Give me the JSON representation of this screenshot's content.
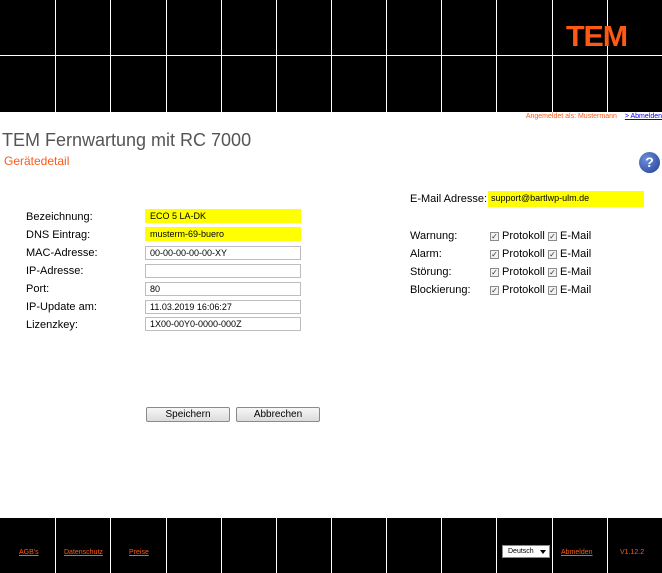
{
  "header": {
    "logo": "TEM"
  },
  "userbar": {
    "logged_in_as": "Angemeldet als: Mustermann",
    "logout": "> Abmelden"
  },
  "page": {
    "title": "TEM Fernwartung mit RC 7000",
    "subtitle": "Gerätedetail",
    "help": "?"
  },
  "device": {
    "name_label": "Bezeichnung:",
    "name": "ECO 5 LA-DK",
    "dns_label": "DNS Eintrag:",
    "dns": "musterm-69-buero",
    "mac_label": "MAC-Adresse:",
    "mac": "00-00-00-00-00-XY",
    "ip_label": "IP-Adresse:",
    "ip": "",
    "port_label": "Port:",
    "port": "80",
    "ipupdate_label": "IP-Update am:",
    "ipupdate": "11.03.2019 16:06:27",
    "license_label": "Lizenzkey:",
    "license": "1X00-00Y0-0000-000Z"
  },
  "notifications": {
    "email_label": "E-Mail Adresse:",
    "email": "support@bartlwp-ulm.de",
    "protocol_label": "Protokoll",
    "email_option_label": "E-Mail",
    "rows": [
      {
        "label": "Warnung:",
        "protocol": true,
        "email": true
      },
      {
        "label": "Alarm:",
        "protocol": true,
        "email": true
      },
      {
        "label": "Störung:",
        "protocol": true,
        "email": true
      },
      {
        "label": "Blockierung:",
        "protocol": true,
        "email": true
      }
    ]
  },
  "actions": {
    "save": "Speichern",
    "cancel": "Abbrechen"
  },
  "footer": {
    "agb": "AGB's",
    "privacy": "Datenschutz",
    "prices": "Preise",
    "language": "Deutsch",
    "logout": "Abmelden",
    "version": "V1.12.2"
  },
  "colors": {
    "brand_orange": "#ff5a14",
    "highlight_yellow": "#ffff00"
  }
}
